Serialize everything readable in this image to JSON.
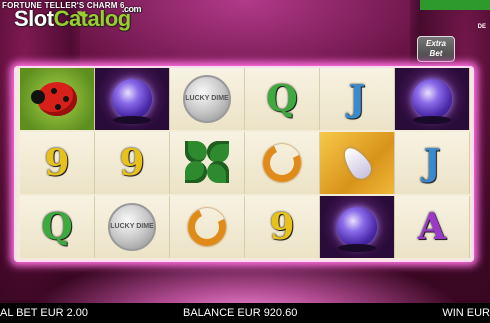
{
  "game": {
    "title": "FORTUNE TELLER'S CHARM 6"
  },
  "watermark": {
    "brand_part1": "Slot",
    "brand_part2": "Catalog",
    "brand_suffix": ".com"
  },
  "top_right": {
    "label": "DE"
  },
  "extra_bet": {
    "label_line1": "Extra",
    "label_line2": "Bet"
  },
  "reels": [
    [
      {
        "symbol": "ladybug",
        "icon": "ladybug-icon"
      },
      {
        "symbol": "9",
        "icon": "nine-icon"
      },
      {
        "symbol": "Q",
        "icon": "queen-icon"
      }
    ],
    [
      {
        "symbol": "crystal-ball",
        "icon": "crystal-ball-icon"
      },
      {
        "symbol": "9",
        "icon": "nine-icon"
      },
      {
        "symbol": "coin",
        "icon": "lucky-dime-coin-icon",
        "text": "LUCKY DIME"
      }
    ],
    [
      {
        "symbol": "coin",
        "icon": "lucky-dime-coin-icon",
        "text": "LUCKY DIME"
      },
      {
        "symbol": "clover",
        "icon": "four-leaf-clover-icon"
      },
      {
        "symbol": "horseshoe",
        "icon": "horseshoe-icon"
      }
    ],
    [
      {
        "symbol": "Q",
        "icon": "queen-icon"
      },
      {
        "symbol": "horseshoe",
        "icon": "horseshoe-icon"
      },
      {
        "symbol": "9",
        "icon": "nine-icon"
      }
    ],
    [
      {
        "symbol": "J",
        "icon": "jack-icon"
      },
      {
        "symbol": "feather",
        "icon": "feather-icon"
      },
      {
        "symbol": "crystal-ball",
        "icon": "crystal-ball-icon"
      }
    ],
    [
      {
        "symbol": "crystal-ball",
        "icon": "crystal-ball-icon"
      },
      {
        "symbol": "J",
        "icon": "jack-icon"
      },
      {
        "symbol": "A",
        "icon": "ace-icon"
      }
    ]
  ],
  "status_bar": {
    "total_bet": "AL BET EUR 2.00",
    "balance": "BALANCE EUR 920.60",
    "win": "WIN EUR"
  }
}
